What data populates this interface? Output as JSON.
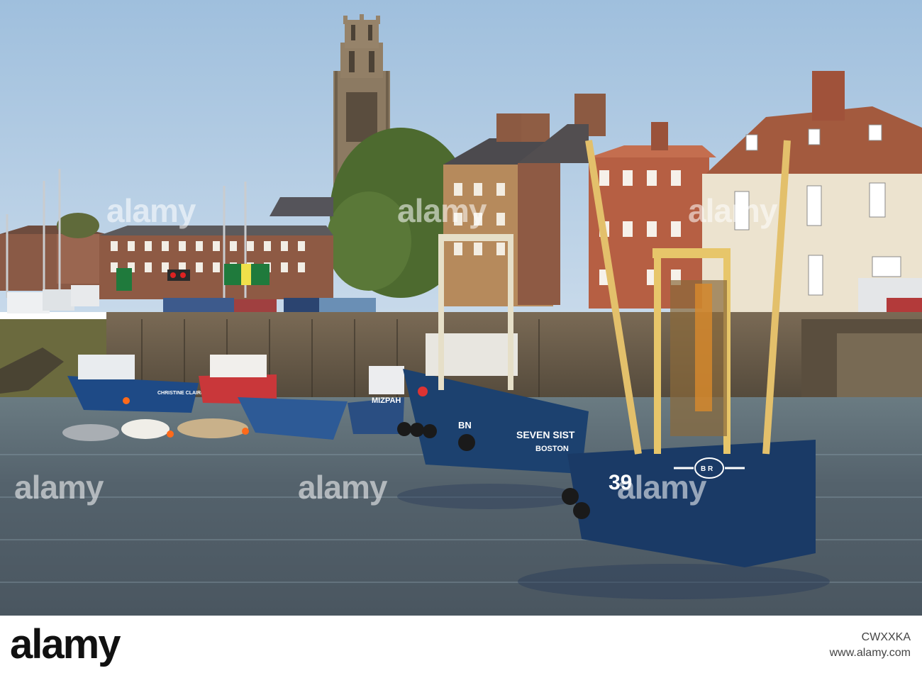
{
  "watermark": {
    "text": "alamy",
    "url_text": "www.alamy.com",
    "image_id": "CWXXKA"
  },
  "boat_labels": {
    "seven_sisters": "SEVEN SIST",
    "boston": "BOSTON",
    "bn": "BN",
    "number_39": "39",
    "br_emblem": "B R",
    "mizpah": "MIZPAH",
    "christine_claire": "CHRISTINE CLAIRE"
  },
  "colors": {
    "sky": "#a9c7e2",
    "water": "#54606a",
    "hull_blue": "#1c3f6e",
    "brick": "#9a5a42",
    "tower": "#8f7b63",
    "gantry_yellow": "#e7c66a"
  }
}
